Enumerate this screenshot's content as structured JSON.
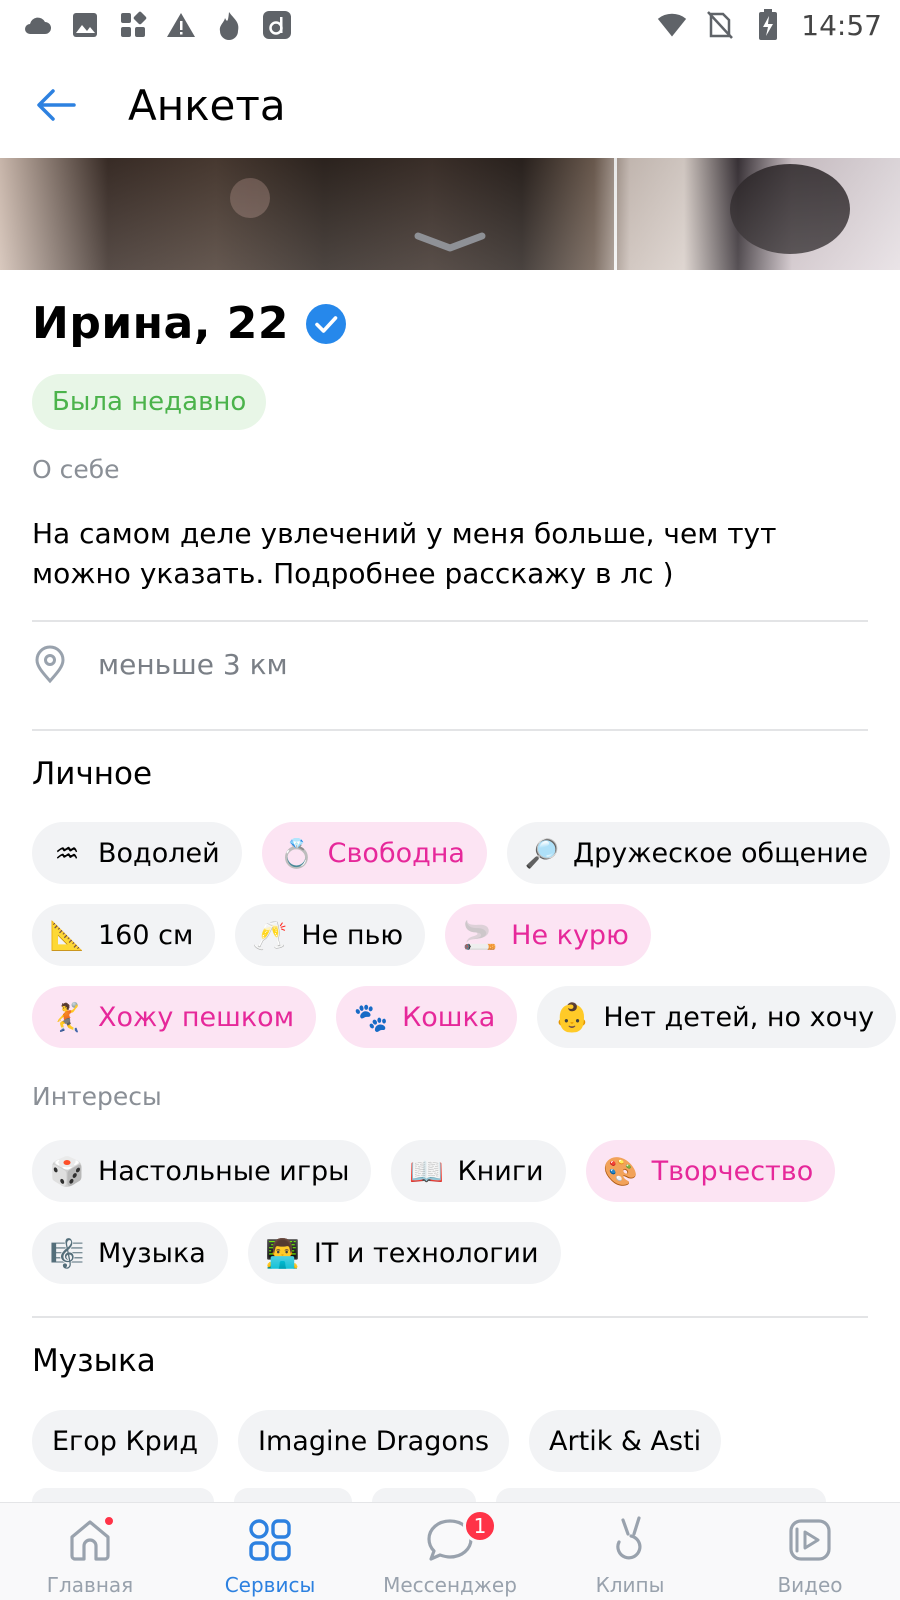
{
  "status_bar": {
    "time": "14:57",
    "left_icons": [
      "cloud-icon",
      "image-icon",
      "apps-icon",
      "warning-icon",
      "flame-icon",
      "d-app-icon"
    ],
    "right_icons": [
      "wifi-icon",
      "no-sim-icon",
      "battery-charging-icon"
    ]
  },
  "header": {
    "title": "Анкета",
    "back_icon": "arrow-left-icon"
  },
  "profile": {
    "name_age": "Ирина, 22",
    "verified_icon": "verified-check-icon",
    "status": "Была недавно",
    "about_label": "О себе",
    "about_text": "На самом деле увлечений у меня больше, чем тут можно указать. Подробнее расскажу в лс )",
    "distance": "меньше 3 км"
  },
  "personal": {
    "title": "Личное",
    "chips": [
      {
        "emoji": "♒",
        "label": "Водолей",
        "highlight": false
      },
      {
        "emoji": "💍",
        "label": "Свободна",
        "highlight": true
      },
      {
        "emoji": "🔎",
        "label": "Дружеское общение",
        "highlight": false
      },
      {
        "emoji": "📐",
        "label": "160 см",
        "highlight": false
      },
      {
        "emoji": "🥂",
        "label": "Не пью",
        "highlight": false
      },
      {
        "emoji": "🚬",
        "label": "Не курю",
        "highlight": true
      },
      {
        "emoji": "🤾",
        "label": "Хожу пешком",
        "highlight": true
      },
      {
        "emoji": "🐾",
        "label": "Кошка",
        "highlight": true
      },
      {
        "emoji": "👶",
        "label": "Нет детей, но хочу",
        "highlight": false
      }
    ]
  },
  "interests": {
    "title": "Интересы",
    "chips": [
      {
        "emoji": "🎲",
        "label": "Настольные игры",
        "highlight": false
      },
      {
        "emoji": "📖",
        "label": "Книги",
        "highlight": false
      },
      {
        "emoji": "🎨",
        "label": "Творчество",
        "highlight": true
      },
      {
        "emoji": "🎼",
        "label": "Музыка",
        "highlight": false
      },
      {
        "emoji": "👨‍💻",
        "label": "IT и технологии",
        "highlight": false
      }
    ]
  },
  "music": {
    "title": "Музыка",
    "chips": [
      "Егор Крид",
      "Imagine Dragons",
      "Artik & Asti"
    ]
  },
  "tabbar": {
    "tabs": [
      {
        "label": "Главная",
        "icon": "home-icon",
        "active": false,
        "dot": true
      },
      {
        "label": "Сервисы",
        "icon": "services-grid-icon",
        "active": true
      },
      {
        "label": "Мессенджер",
        "icon": "messenger-icon",
        "active": false,
        "badge": "1"
      },
      {
        "label": "Клипы",
        "icon": "clips-icon",
        "active": false
      },
      {
        "label": "Видео",
        "icon": "video-icon",
        "active": false
      }
    ]
  },
  "colors": {
    "accent": "#2d81e0",
    "verified": "#2688eb",
    "online_green": "#4bb34b",
    "pink_text": "#e6289a",
    "pink_bg": "#fce4f3",
    "chip_bg": "#f2f3f5",
    "badge_red": "#ff3347"
  }
}
